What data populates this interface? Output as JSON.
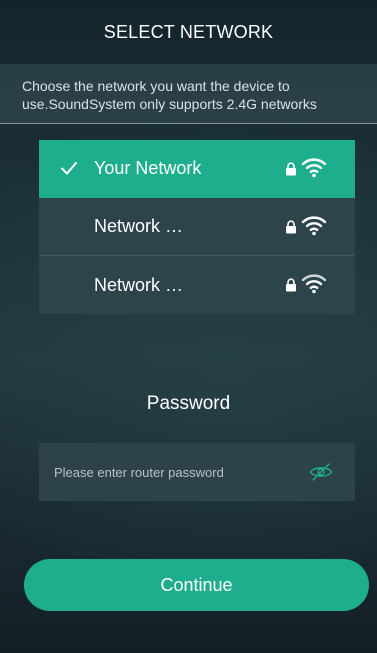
{
  "header": {
    "title": "SELECT NETWORK"
  },
  "instructions": {
    "line1": "Choose the network you want the device to",
    "line2": "use.SoundSystem only supports 2.4G networks"
  },
  "networks": [
    {
      "name": "Your Network",
      "selected": true,
      "locked": true,
      "icon": "wifi-icon"
    },
    {
      "name": "Network …",
      "selected": false,
      "locked": true,
      "icon": "wifi-icon"
    },
    {
      "name": "Network …",
      "selected": false,
      "locked": true,
      "icon": "wifi-icon"
    }
  ],
  "password": {
    "label": "Password",
    "placeholder": "Please enter router password",
    "value": "",
    "visibility_icon": "eye-hidden-icon"
  },
  "actions": {
    "continue_label": "Continue"
  },
  "colors": {
    "accent": "#1fae8d",
    "list_item": "#2e444b",
    "eye_icon": "#1fae8d"
  }
}
